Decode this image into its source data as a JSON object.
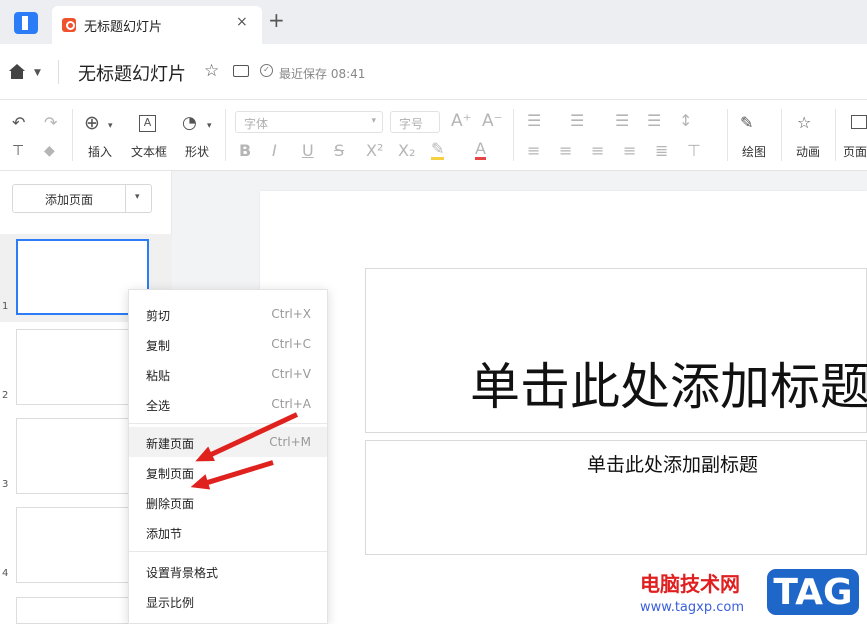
{
  "window": {
    "tab_title": "无标题幻灯片",
    "tab_close": "×",
    "new_tab": "+"
  },
  "header": {
    "title": "无标题幻灯片",
    "save_status": "最近保存 08:41"
  },
  "toolbar": {
    "insert": "插入",
    "textbox": "文本框",
    "shape": "形状",
    "font_placeholder": "字体",
    "size_placeholder": "字号",
    "draw": "绘图",
    "animation": "动画",
    "page": "页面"
  },
  "sidebar": {
    "add_page": "添加页面",
    "slide_numbers": [
      "1",
      "2",
      "3",
      "4"
    ]
  },
  "slide": {
    "title_placeholder": "单击此处添加标题",
    "subtitle_placeholder": "单击此处添加副标题"
  },
  "context_menu": {
    "items": [
      {
        "label": "剪切",
        "shortcut": "Ctrl+X"
      },
      {
        "label": "复制",
        "shortcut": "Ctrl+C"
      },
      {
        "label": "粘贴",
        "shortcut": "Ctrl+V"
      },
      {
        "label": "全选",
        "shortcut": "Ctrl+A"
      },
      {
        "label": "新建页面",
        "shortcut": "Ctrl+M"
      },
      {
        "label": "复制页面",
        "shortcut": ""
      },
      {
        "label": "删除页面",
        "shortcut": ""
      },
      {
        "label": "添加节",
        "shortcut": ""
      },
      {
        "label": "设置背景格式",
        "shortcut": ""
      },
      {
        "label": "显示比例",
        "shortcut": ""
      }
    ]
  },
  "watermark": {
    "site_name": "电脑技术网",
    "url": "www.tagxp.com",
    "badge": "TAG"
  },
  "colors": {
    "accent": "#2b7cf6",
    "arrow": "#e0221f",
    "tab_icon": "#f0522d"
  }
}
